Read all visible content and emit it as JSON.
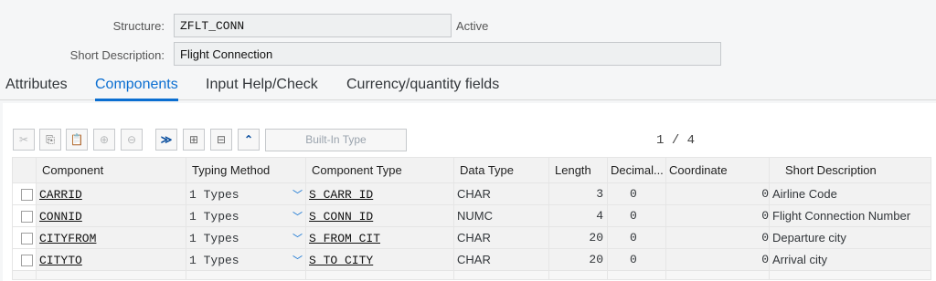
{
  "header": {
    "structure_label": "Structure:",
    "structure_value": "ZFLT_CONN",
    "status": "Active",
    "short_desc_label": "Short Description:",
    "short_desc_value": "Flight Connection"
  },
  "tabs": [
    {
      "label": "Attributes"
    },
    {
      "label": "Components"
    },
    {
      "label": "Input Help/Check"
    },
    {
      "label": "Currency/quantity fields"
    }
  ],
  "toolbar": {
    "builtin_type_label": "Built-In Type",
    "pager_current": "1",
    "pager_sep": "/",
    "pager_total": "4"
  },
  "table": {
    "columns": [
      "Component",
      "Typing Method",
      "Component Type",
      "Data Type",
      "Length",
      "Decimal...",
      "Coordinate",
      "Short Description"
    ],
    "rows": [
      {
        "component": "CARRID",
        "typing": "1 Types",
        "comp_type": "S_CARR_ID",
        "data_type": "CHAR",
        "length": "3",
        "decimals": "0",
        "coordinate": "0",
        "desc": "Airline Code"
      },
      {
        "component": "CONNID",
        "typing": "1 Types",
        "comp_type": "S_CONN_ID",
        "data_type": "NUMC",
        "length": "4",
        "decimals": "0",
        "coordinate": "0",
        "desc": "Flight Connection Number"
      },
      {
        "component": "CITYFROM",
        "typing": "1 Types",
        "comp_type": "S_FROM_CIT",
        "data_type": "CHAR",
        "length": "20",
        "decimals": "0",
        "coordinate": "0",
        "desc": "Departure city"
      },
      {
        "component": "CITYTO",
        "typing": "1 Types",
        "comp_type": "S_TO_CITY",
        "data_type": "CHAR",
        "length": "20",
        "decimals": "0",
        "coordinate": "0",
        "desc": "Arrival city"
      }
    ]
  },
  "icons": [
    "cut-icon",
    "copy-icon",
    "paste-icon",
    "insert-row-icon",
    "delete-row-icon",
    "scroll-bottom-icon",
    "scroll-next-icon",
    "scroll-prev-icon",
    "scroll-top-icon",
    "chevron-down-icon"
  ],
  "colors": {
    "accent": "#0a6ed1",
    "field_bg": "#eef0f1"
  }
}
